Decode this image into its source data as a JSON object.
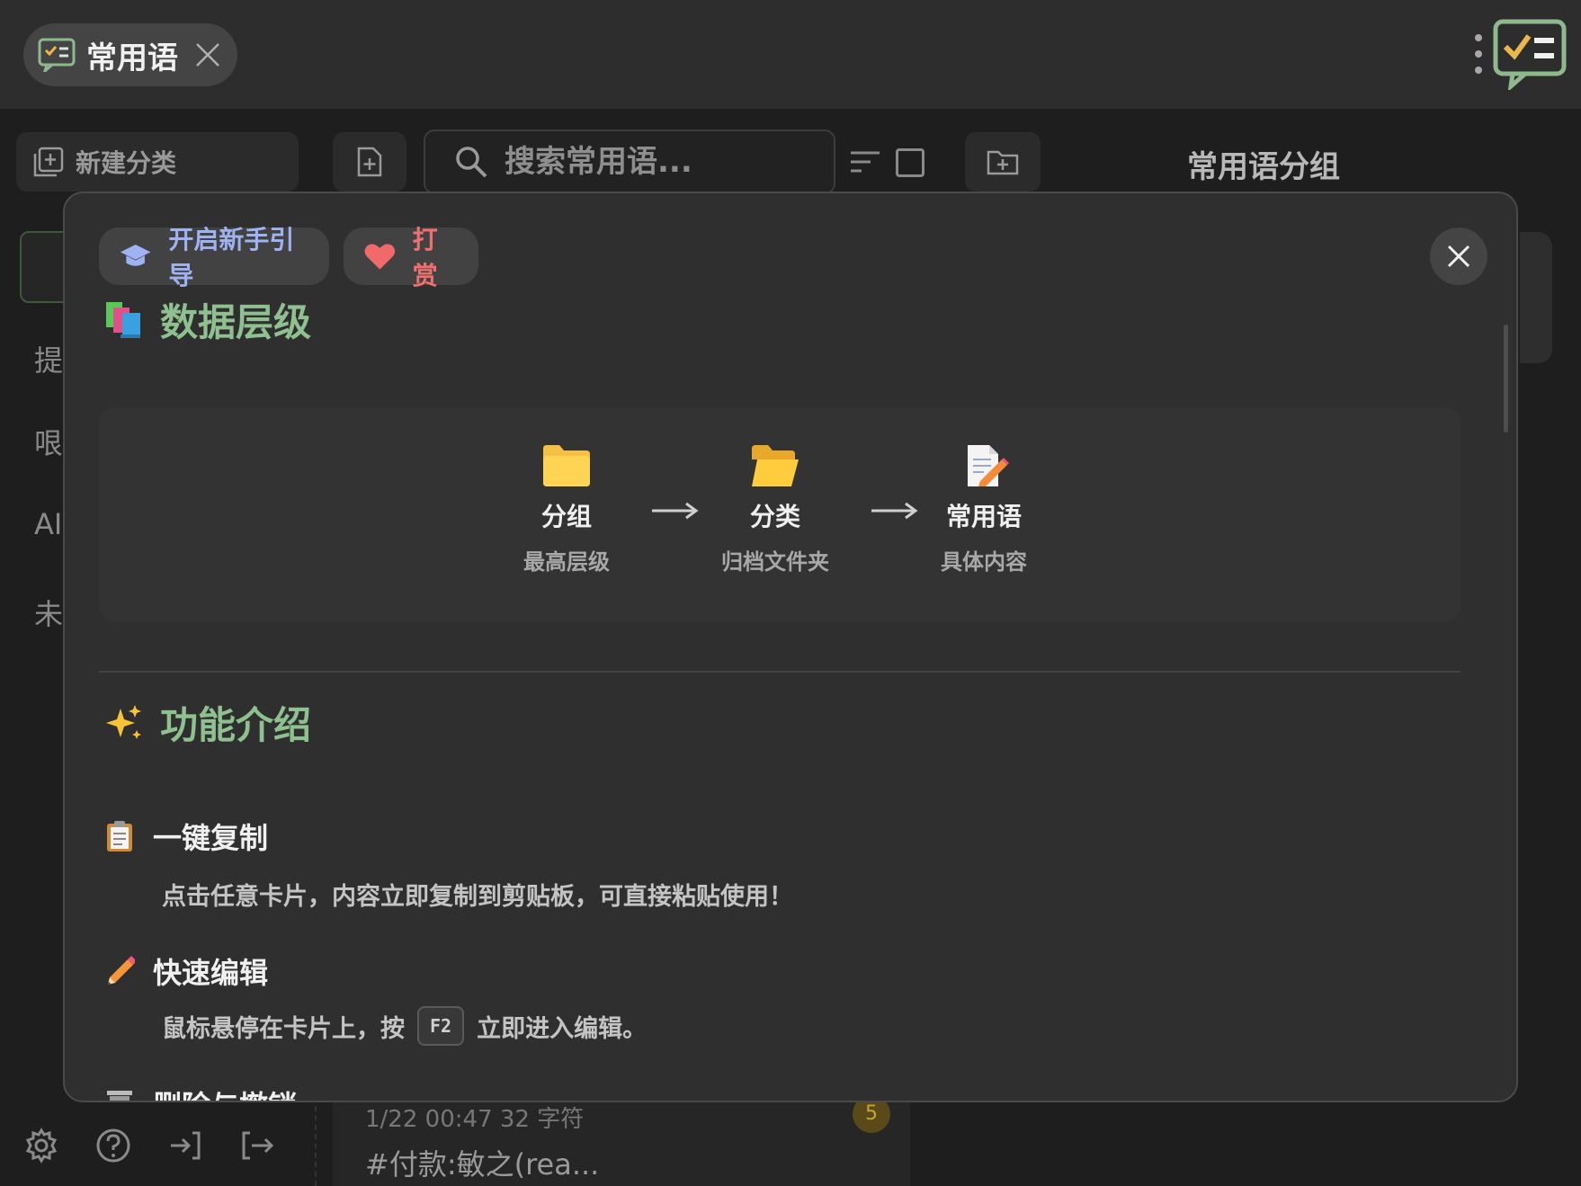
{
  "tab": {
    "title": "常用语",
    "close_label": "×"
  },
  "toolbar": {
    "new_category_label": "新建分类",
    "search_placeholder": "搜索常用语...",
    "group_panel_title": "常用语分组"
  },
  "sidebar_partial": [
    "提",
    "哏",
    "AI",
    "未"
  ],
  "background_card": {
    "meta": "1/22 00:47  32 字符",
    "badge": "5",
    "text": "#付款:敏之(rea..."
  },
  "modal": {
    "guide_button": "开启新手引导",
    "donate_button": "打赏",
    "hierarchy": {
      "title": "数据层级",
      "nodes": [
        {
          "name": "分组",
          "sub": "最高层级",
          "icon": "folder-icon"
        },
        {
          "name": "分类",
          "sub": "归档文件夹",
          "icon": "open-folder-icon"
        },
        {
          "name": "常用语",
          "sub": "具体内容",
          "icon": "memo-icon"
        }
      ]
    },
    "features": {
      "title": "功能介绍",
      "items": [
        {
          "name": "一键复制",
          "icon": "clipboard-icon",
          "desc": "点击任意卡片，内容立即复制到剪贴板，可直接粘贴使用！"
        },
        {
          "name": "快速编辑",
          "icon": "pencil-icon",
          "desc_before": "鼠标悬停在卡片上，按",
          "key": "F2",
          "desc_after": "立即进入编辑。"
        },
        {
          "name": "删除与撤销",
          "icon": "trash-icon"
        }
      ]
    }
  },
  "colors": {
    "accent_green": "#8fc08f",
    "guide_blue": "#9fb2f2",
    "donate_red": "#f07070",
    "folder_yellow": "#f5c043"
  }
}
